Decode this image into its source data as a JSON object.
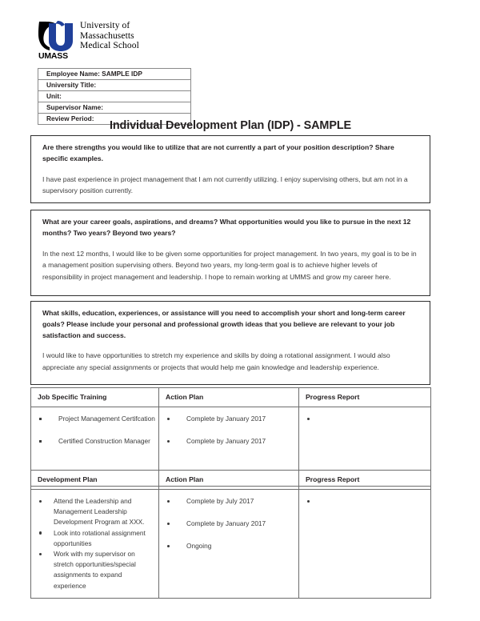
{
  "letterhead": {
    "logo_icon": "umass-u-logo-icon",
    "wordmark": "UMASS",
    "name_line_1": "University of",
    "name_line_2": "Massachusetts",
    "name_line_3": "Medical School",
    "logo_blue": "#20409a",
    "logo_black": "#000000"
  },
  "employee_info": {
    "rows": [
      "Employee Name: SAMPLE IDP",
      "University Title:",
      "Unit:",
      "Supervisor Name:",
      "Review Period:"
    ]
  },
  "document": {
    "title": "Individual Development Plan (IDP) - SAMPLE"
  },
  "questions": [
    {
      "prompt": "Are there strengths you would like to utilize that are not currently a part of your position description? Share specific examples.",
      "answer": "I have past experience in project management that I am not currently utilizing. I enjoy supervising others, but am not in a supervisory position currently."
    },
    {
      "prompt": "What are your career goals, aspirations, and dreams? What opportunities would you like to pursue in the next 12 months? Two years? Beyond two years?",
      "answer": "In the next 12 months, I would like to be given some opportunities for project management. In two years, my goal is to be in a management position supervising others. Beyond two years, my long-term goal is to achieve higher levels of responsibility in project management and leadership. I hope to remain working at UMMS and grow my career here."
    },
    {
      "prompt": "What skills, education, experiences, or assistance will you need to accomplish your short and long-term career goals? Please include your personal and professional growth ideas that you believe are relevant to your job satisfaction and success.",
      "answer": "I would like to have opportunities to stretch my experience and skills by doing a rotational assignment. I would also appreciate any special assignments or projects that would help me gain knowledge and leadership experience."
    }
  ],
  "plan_tables": [
    {
      "headers": [
        "Job Specific Training",
        "Action Plan",
        "Progress Report"
      ],
      "items": [
        "Project Management Certifcation",
        "Certified Construction Manager"
      ],
      "actions": [
        "Complete by January 2017",
        "Complete by January 2017"
      ],
      "progress": [
        ""
      ]
    },
    {
      "headers": [
        "Development Plan",
        "Action Plan",
        "Progress Report"
      ],
      "items": [
        "Attend the Leadership and Management  Leadership Development Program at XXX.",
        "Look into rotational assignment opportunities",
        "Work with my supervisor on stretch opportunities/special assignments to expand experience"
      ],
      "actions": [
        "Complete by July 2017",
        "Complete by January 2017",
        "Ongoing"
      ],
      "progress": [
        ""
      ]
    }
  ]
}
